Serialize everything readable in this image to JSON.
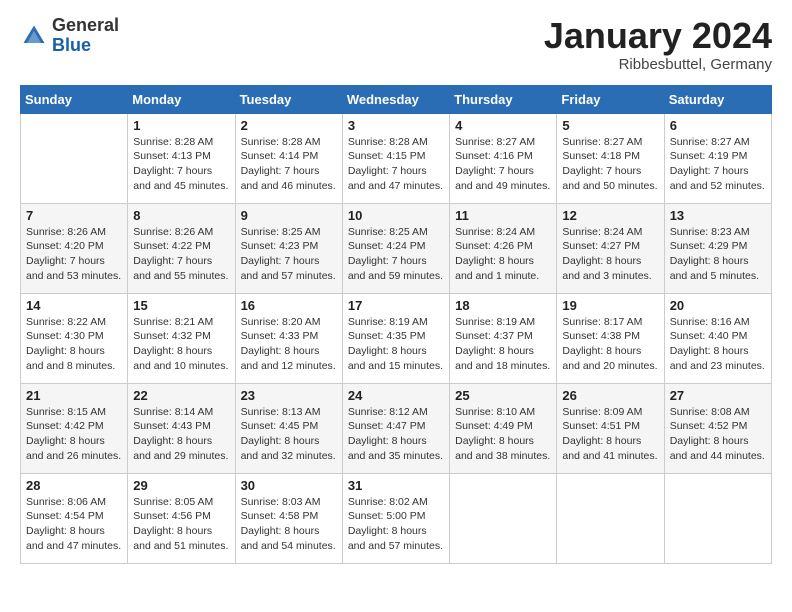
{
  "header": {
    "logo_general": "General",
    "logo_blue": "Blue",
    "month_title": "January 2024",
    "subtitle": "Ribbesbuttel, Germany"
  },
  "days_of_week": [
    "Sunday",
    "Monday",
    "Tuesday",
    "Wednesday",
    "Thursday",
    "Friday",
    "Saturday"
  ],
  "weeks": [
    [
      {
        "day": "",
        "sunrise": "",
        "sunset": "",
        "daylight": ""
      },
      {
        "day": "1",
        "sunrise": "Sunrise: 8:28 AM",
        "sunset": "Sunset: 4:13 PM",
        "daylight": "Daylight: 7 hours and 45 minutes."
      },
      {
        "day": "2",
        "sunrise": "Sunrise: 8:28 AM",
        "sunset": "Sunset: 4:14 PM",
        "daylight": "Daylight: 7 hours and 46 minutes."
      },
      {
        "day": "3",
        "sunrise": "Sunrise: 8:28 AM",
        "sunset": "Sunset: 4:15 PM",
        "daylight": "Daylight: 7 hours and 47 minutes."
      },
      {
        "day": "4",
        "sunrise": "Sunrise: 8:27 AM",
        "sunset": "Sunset: 4:16 PM",
        "daylight": "Daylight: 7 hours and 49 minutes."
      },
      {
        "day": "5",
        "sunrise": "Sunrise: 8:27 AM",
        "sunset": "Sunset: 4:18 PM",
        "daylight": "Daylight: 7 hours and 50 minutes."
      },
      {
        "day": "6",
        "sunrise": "Sunrise: 8:27 AM",
        "sunset": "Sunset: 4:19 PM",
        "daylight": "Daylight: 7 hours and 52 minutes."
      }
    ],
    [
      {
        "day": "7",
        "sunrise": "Sunrise: 8:26 AM",
        "sunset": "Sunset: 4:20 PM",
        "daylight": "Daylight: 7 hours and 53 minutes."
      },
      {
        "day": "8",
        "sunrise": "Sunrise: 8:26 AM",
        "sunset": "Sunset: 4:22 PM",
        "daylight": "Daylight: 7 hours and 55 minutes."
      },
      {
        "day": "9",
        "sunrise": "Sunrise: 8:25 AM",
        "sunset": "Sunset: 4:23 PM",
        "daylight": "Daylight: 7 hours and 57 minutes."
      },
      {
        "day": "10",
        "sunrise": "Sunrise: 8:25 AM",
        "sunset": "Sunset: 4:24 PM",
        "daylight": "Daylight: 7 hours and 59 minutes."
      },
      {
        "day": "11",
        "sunrise": "Sunrise: 8:24 AM",
        "sunset": "Sunset: 4:26 PM",
        "daylight": "Daylight: 8 hours and 1 minute."
      },
      {
        "day": "12",
        "sunrise": "Sunrise: 8:24 AM",
        "sunset": "Sunset: 4:27 PM",
        "daylight": "Daylight: 8 hours and 3 minutes."
      },
      {
        "day": "13",
        "sunrise": "Sunrise: 8:23 AM",
        "sunset": "Sunset: 4:29 PM",
        "daylight": "Daylight: 8 hours and 5 minutes."
      }
    ],
    [
      {
        "day": "14",
        "sunrise": "Sunrise: 8:22 AM",
        "sunset": "Sunset: 4:30 PM",
        "daylight": "Daylight: 8 hours and 8 minutes."
      },
      {
        "day": "15",
        "sunrise": "Sunrise: 8:21 AM",
        "sunset": "Sunset: 4:32 PM",
        "daylight": "Daylight: 8 hours and 10 minutes."
      },
      {
        "day": "16",
        "sunrise": "Sunrise: 8:20 AM",
        "sunset": "Sunset: 4:33 PM",
        "daylight": "Daylight: 8 hours and 12 minutes."
      },
      {
        "day": "17",
        "sunrise": "Sunrise: 8:19 AM",
        "sunset": "Sunset: 4:35 PM",
        "daylight": "Daylight: 8 hours and 15 minutes."
      },
      {
        "day": "18",
        "sunrise": "Sunrise: 8:19 AM",
        "sunset": "Sunset: 4:37 PM",
        "daylight": "Daylight: 8 hours and 18 minutes."
      },
      {
        "day": "19",
        "sunrise": "Sunrise: 8:17 AM",
        "sunset": "Sunset: 4:38 PM",
        "daylight": "Daylight: 8 hours and 20 minutes."
      },
      {
        "day": "20",
        "sunrise": "Sunrise: 8:16 AM",
        "sunset": "Sunset: 4:40 PM",
        "daylight": "Daylight: 8 hours and 23 minutes."
      }
    ],
    [
      {
        "day": "21",
        "sunrise": "Sunrise: 8:15 AM",
        "sunset": "Sunset: 4:42 PM",
        "daylight": "Daylight: 8 hours and 26 minutes."
      },
      {
        "day": "22",
        "sunrise": "Sunrise: 8:14 AM",
        "sunset": "Sunset: 4:43 PM",
        "daylight": "Daylight: 8 hours and 29 minutes."
      },
      {
        "day": "23",
        "sunrise": "Sunrise: 8:13 AM",
        "sunset": "Sunset: 4:45 PM",
        "daylight": "Daylight: 8 hours and 32 minutes."
      },
      {
        "day": "24",
        "sunrise": "Sunrise: 8:12 AM",
        "sunset": "Sunset: 4:47 PM",
        "daylight": "Daylight: 8 hours and 35 minutes."
      },
      {
        "day": "25",
        "sunrise": "Sunrise: 8:10 AM",
        "sunset": "Sunset: 4:49 PM",
        "daylight": "Daylight: 8 hours and 38 minutes."
      },
      {
        "day": "26",
        "sunrise": "Sunrise: 8:09 AM",
        "sunset": "Sunset: 4:51 PM",
        "daylight": "Daylight: 8 hours and 41 minutes."
      },
      {
        "day": "27",
        "sunrise": "Sunrise: 8:08 AM",
        "sunset": "Sunset: 4:52 PM",
        "daylight": "Daylight: 8 hours and 44 minutes."
      }
    ],
    [
      {
        "day": "28",
        "sunrise": "Sunrise: 8:06 AM",
        "sunset": "Sunset: 4:54 PM",
        "daylight": "Daylight: 8 hours and 47 minutes."
      },
      {
        "day": "29",
        "sunrise": "Sunrise: 8:05 AM",
        "sunset": "Sunset: 4:56 PM",
        "daylight": "Daylight: 8 hours and 51 minutes."
      },
      {
        "day": "30",
        "sunrise": "Sunrise: 8:03 AM",
        "sunset": "Sunset: 4:58 PM",
        "daylight": "Daylight: 8 hours and 54 minutes."
      },
      {
        "day": "31",
        "sunrise": "Sunrise: 8:02 AM",
        "sunset": "Sunset: 5:00 PM",
        "daylight": "Daylight: 8 hours and 57 minutes."
      },
      {
        "day": "",
        "sunrise": "",
        "sunset": "",
        "daylight": ""
      },
      {
        "day": "",
        "sunrise": "",
        "sunset": "",
        "daylight": ""
      },
      {
        "day": "",
        "sunrise": "",
        "sunset": "",
        "daylight": ""
      }
    ]
  ]
}
